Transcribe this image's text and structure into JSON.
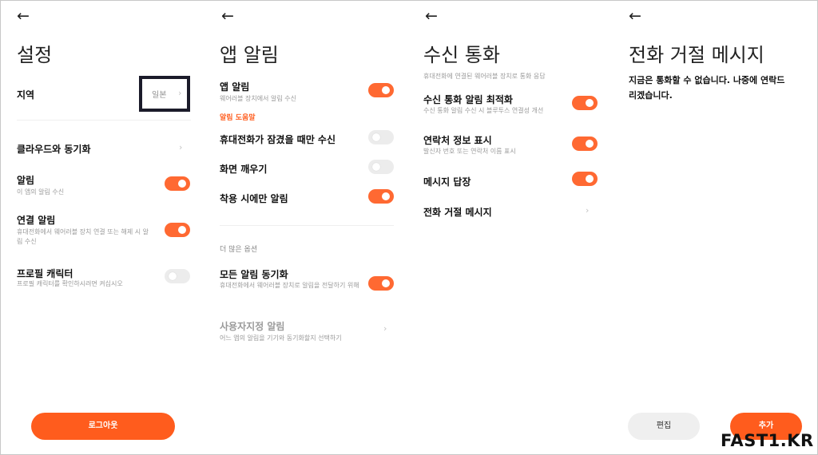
{
  "screen1": {
    "title": "설정",
    "region": {
      "label": "지역",
      "value": "일본"
    },
    "cloud_sync": {
      "label": "클라우드와 동기화"
    },
    "notifications": {
      "label": "알림",
      "desc": "이 앱의 알림 수신",
      "enabled": true
    },
    "connection_alert": {
      "label": "연결 알림",
      "desc": "휴대전화에서 웨어러블 장치 연결 또는 해제 시 알림 수신",
      "enabled": true
    },
    "profile_character": {
      "label": "프로필 캐릭터",
      "desc": "프로필 캐릭터를 확인하시려면 켜십시오",
      "enabled": false
    },
    "logout_label": "로그아웃"
  },
  "screen2": {
    "title": "앱 알림",
    "app_alert": {
      "label": "앱 알림",
      "desc": "웨어러블 장치에서 알림 수신",
      "enabled": true
    },
    "section_helper": "알림 도움말",
    "receive_locked": {
      "label": "휴대전화가 잠겼을 때만 수신",
      "enabled": false
    },
    "wake_screen": {
      "label": "화면 깨우기",
      "enabled": false
    },
    "only_wearing": {
      "label": "착용 시에만 알림",
      "enabled": true
    },
    "section_more": "더 많은 옵션",
    "sync_all": {
      "label": "모든 알림 동기화",
      "desc": "휴대전화에서 웨어러블 장치로 알림을 전달하기 위해",
      "enabled": true
    },
    "custom_alert": {
      "label": "사용자지정 알림",
      "desc": "어느 앱의 알림을 기기와 동기화할지 선택하기"
    }
  },
  "screen3": {
    "title": "수신 통화",
    "subtitle": "휴대전화에 연결된 웨어러블 장치로 통화 응답",
    "optimize": {
      "label": "수신 통화 알림 최적화",
      "desc": "수신 통화 알림 수신 시 블루투스 연결성 개선",
      "enabled": true
    },
    "contact_info": {
      "label": "연락처 정보 표시",
      "desc": "발신자 번호 또는 연락처 이름 표시",
      "enabled": true
    },
    "message_reply": {
      "label": "메시지 답장",
      "enabled": true
    },
    "reject_message": {
      "label": "전화 거절 메시지"
    }
  },
  "screen4": {
    "title": "전화 거절 메시지",
    "message": "지금은 통화할 수 없습니다. 나중에 연락드리겠습니다.",
    "edit_label": "편집",
    "add_label": "추가"
  },
  "watermark": "FAST1.KR",
  "colors": {
    "accent": "#ff5c1d",
    "toggle_on": "#ff6932",
    "toggle_off": "#ececec",
    "muted_text": "#9a9a9a"
  },
  "icons": {
    "back": "back-arrow-icon",
    "chevron": "chevron-right-icon"
  }
}
